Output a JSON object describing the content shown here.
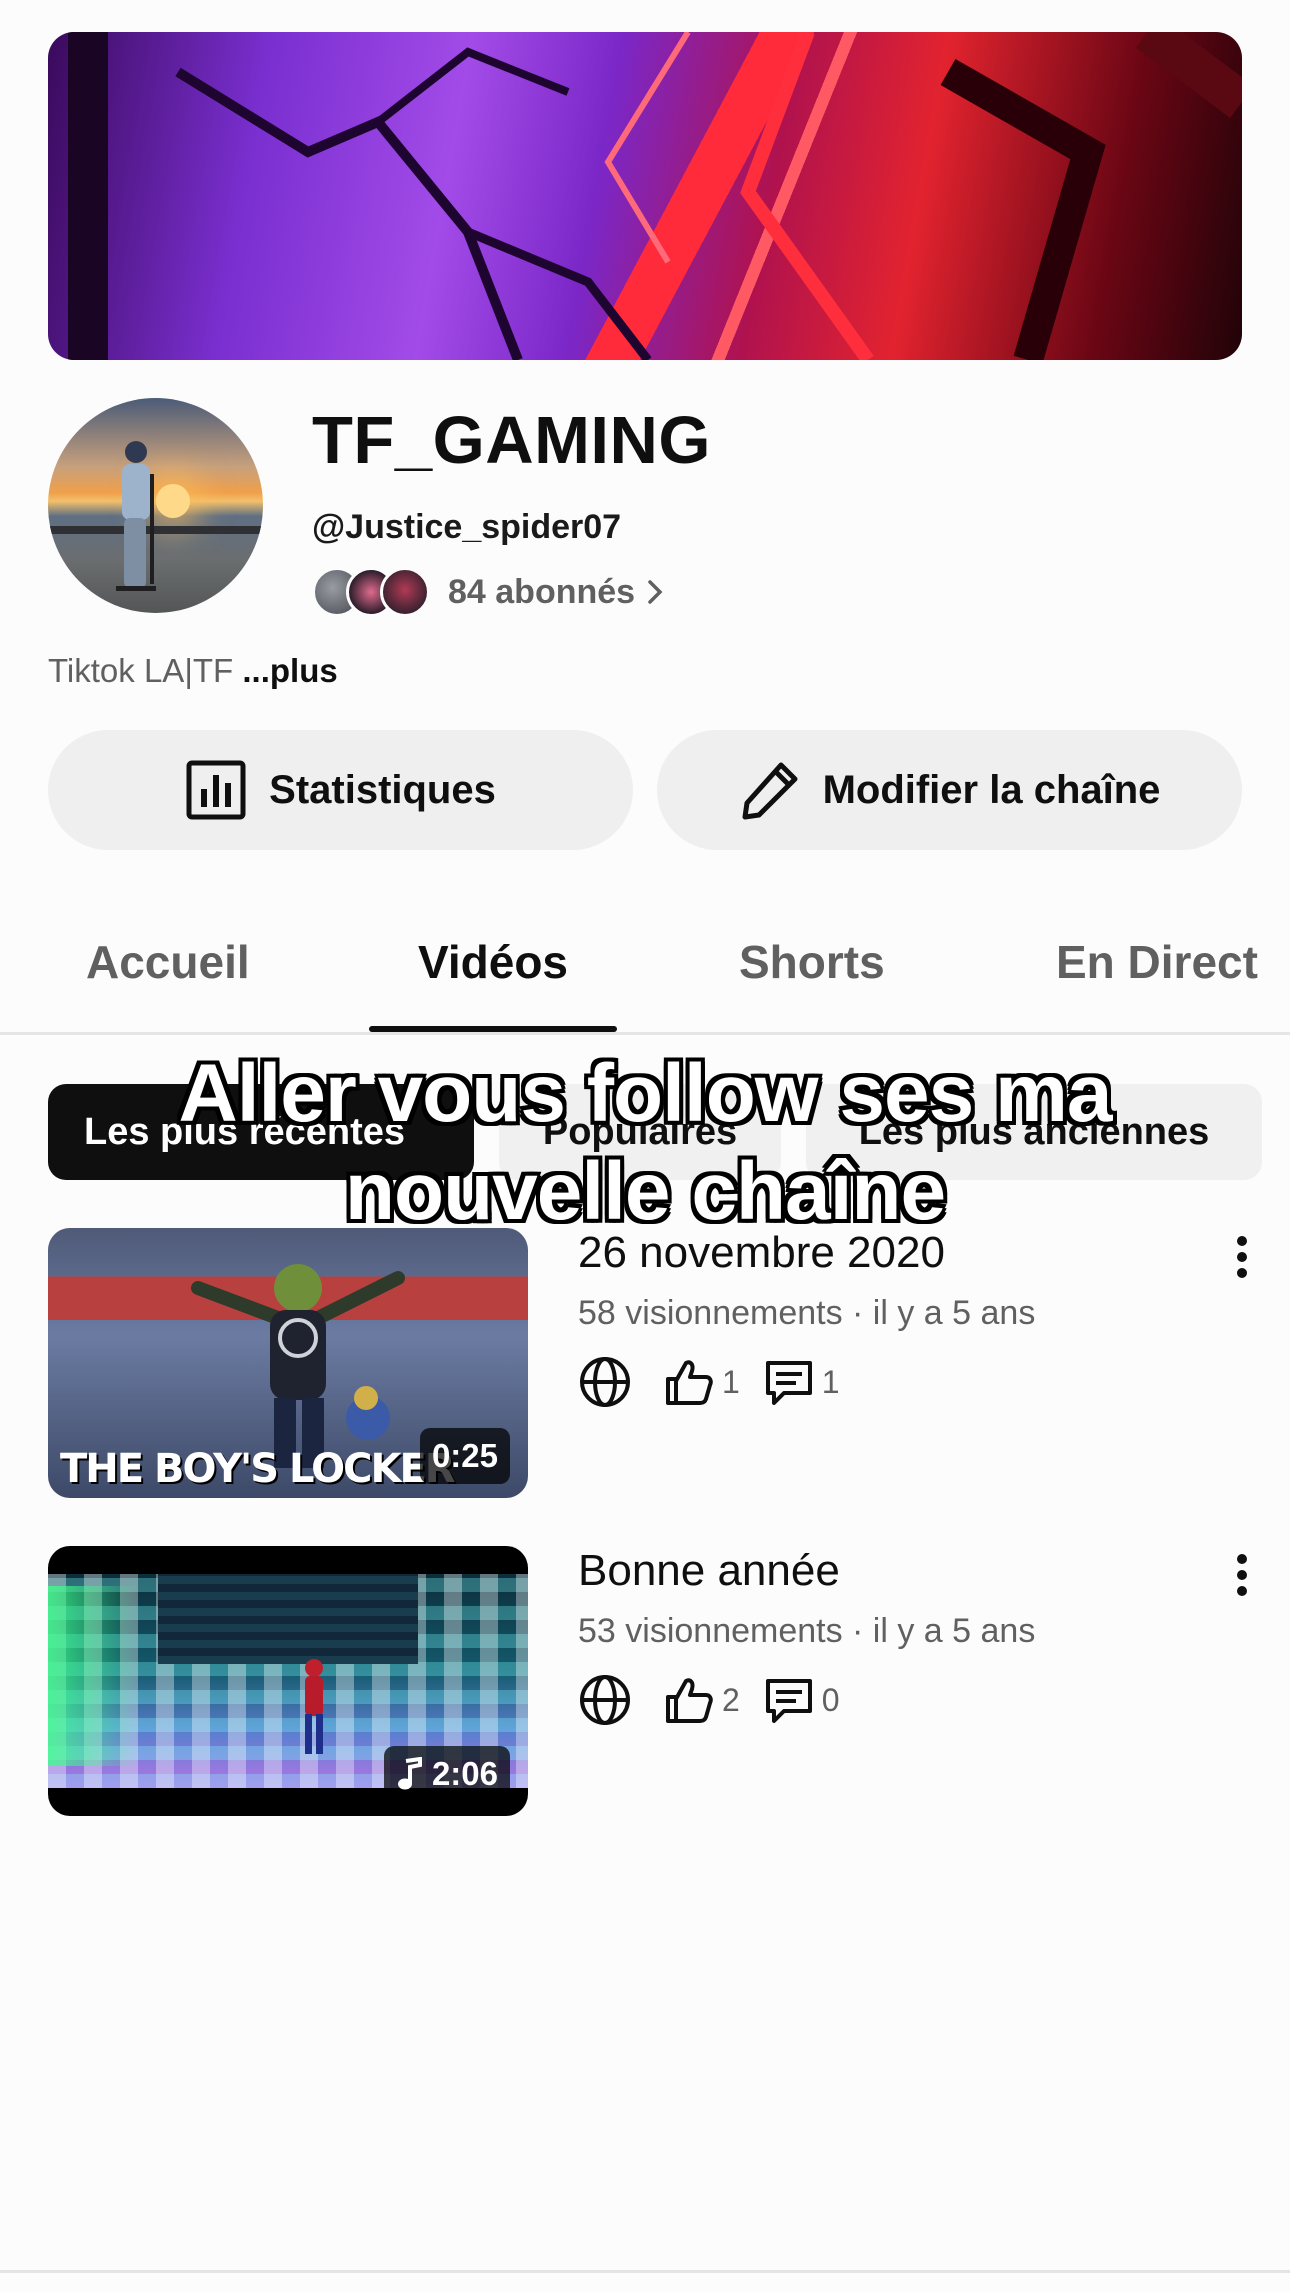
{
  "channel": {
    "name": "TF_GAMING",
    "handle": "@Justice_spider07",
    "subscribers": "84 abonnés",
    "description": "Tiktok LA|TF",
    "more_label": "...plus"
  },
  "actions": {
    "stats_label": "Statistiques",
    "edit_label": "Modifier la chaîne"
  },
  "tabs": [
    {
      "label": "Accueil",
      "active": false
    },
    {
      "label": "Vidéos",
      "active": true
    },
    {
      "label": "Shorts",
      "active": false
    },
    {
      "label": "En Direct",
      "active": false
    }
  ],
  "filters": [
    {
      "label": "Les plus récentes",
      "active": true
    },
    {
      "label": "Populaires",
      "active": false
    },
    {
      "label": "Les plus anciennes",
      "active": false
    }
  ],
  "overlay_caption": "Aller vous follow ses ma nouvelle chaîne",
  "videos": [
    {
      "title": "26 novembre 2020",
      "meta": "58 visionnements · il y a 5 ans",
      "likes": "1",
      "comments": "1",
      "duration": "0:25",
      "thumb_caption": "THE BOY'S LOCKER ROOM"
    },
    {
      "title": "Bonne année",
      "meta": "53 visionnements · il y a 5 ans",
      "likes": "2",
      "comments": "0",
      "duration": "2:06"
    }
  ],
  "icons": {
    "stats": "bar-chart-icon",
    "edit": "pencil-icon",
    "visibility": "globe-icon",
    "like": "thumbs-up-icon",
    "comment": "comment-icon",
    "menu": "kebab-icon",
    "music": "music-note-icon"
  },
  "colors": {
    "active_chip": "#0f0f0f",
    "chip_bg": "#f0f0f0",
    "secondary_text": "#606060"
  }
}
